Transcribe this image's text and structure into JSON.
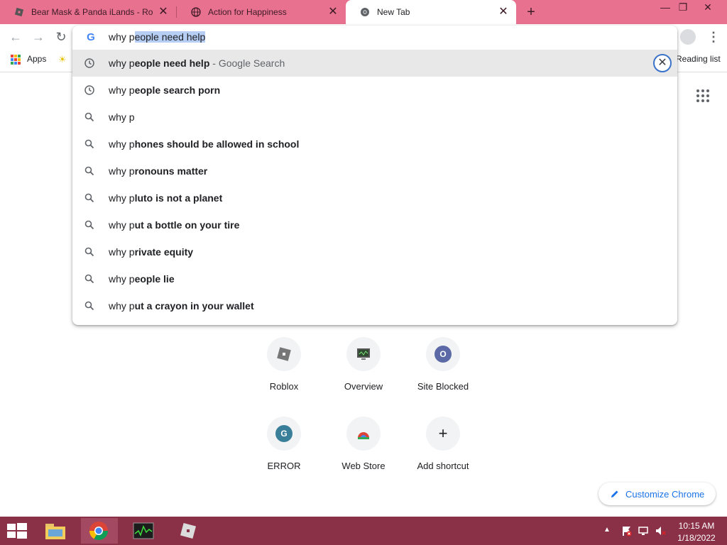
{
  "tabs": [
    {
      "title": "Bear Mask & Panda iLands - Robl",
      "favicon": "roblox-icon"
    },
    {
      "title": "Action for Happiness",
      "favicon": "globe-icon"
    },
    {
      "title": "New Tab",
      "favicon": "chrome-icon"
    }
  ],
  "window": {
    "minimize": "—",
    "restore": "❐",
    "close": "✕"
  },
  "toolbar": {
    "back": "←",
    "forward": "→",
    "reload": "↻"
  },
  "bookmarks": {
    "apps_label": "Apps",
    "reading_list": "Reading list"
  },
  "omnibox": {
    "typed": "why p",
    "autocomplete": "eople need help",
    "remove_label": "✕",
    "suggestions": [
      {
        "icon": "history-clock-icon",
        "prefix": "why p",
        "bold": "eople need help",
        "suffix": " - Google Search"
      },
      {
        "icon": "history-clock-icon",
        "prefix": "why p",
        "bold": "eople search porn",
        "suffix": ""
      },
      {
        "icon": "search-icon",
        "prefix": "why p",
        "bold": "",
        "suffix": ""
      },
      {
        "icon": "search-icon",
        "prefix": "why p",
        "bold": "hones should be allowed in school",
        "suffix": ""
      },
      {
        "icon": "search-icon",
        "prefix": "why p",
        "bold": "ronouns matter",
        "suffix": ""
      },
      {
        "icon": "search-icon",
        "prefix": "why p",
        "bold": "luto is not a planet",
        "suffix": ""
      },
      {
        "icon": "search-icon",
        "prefix": "why p",
        "bold": "ut a bottle on your tire",
        "suffix": ""
      },
      {
        "icon": "search-icon",
        "prefix": "why p",
        "bold": "rivate equity",
        "suffix": ""
      },
      {
        "icon": "search-icon",
        "prefix": "why p",
        "bold": "eople lie",
        "suffix": ""
      },
      {
        "icon": "search-icon",
        "prefix": "why p",
        "bold": "ut a crayon in your wallet",
        "suffix": ""
      }
    ]
  },
  "shortcuts": [
    {
      "label": "Roblox",
      "glyph": "",
      "color": "#6f6f6f"
    },
    {
      "label": "Overview",
      "glyph": "",
      "color": "#3a5f3a"
    },
    {
      "label": "Site Blocked",
      "glyph": "O",
      "color": "#5b6aa7"
    },
    {
      "label": "ERROR",
      "glyph": "G",
      "color": "#3a7f9a"
    },
    {
      "label": "Web Store",
      "glyph": "",
      "color": "#db4437"
    },
    {
      "label": "Add shortcut",
      "glyph": "+",
      "color": "#f1f3f4"
    }
  ],
  "customize_label": "Customize Chrome",
  "taskbar": {
    "time": "10:15 AM",
    "date": "1/18/2022",
    "tray_arrow": "▲"
  },
  "colors": {
    "tabstrip": "#e8718f",
    "taskbar": "#8a3148",
    "selection": "#b6cdf4",
    "accent": "#1a73e8"
  }
}
